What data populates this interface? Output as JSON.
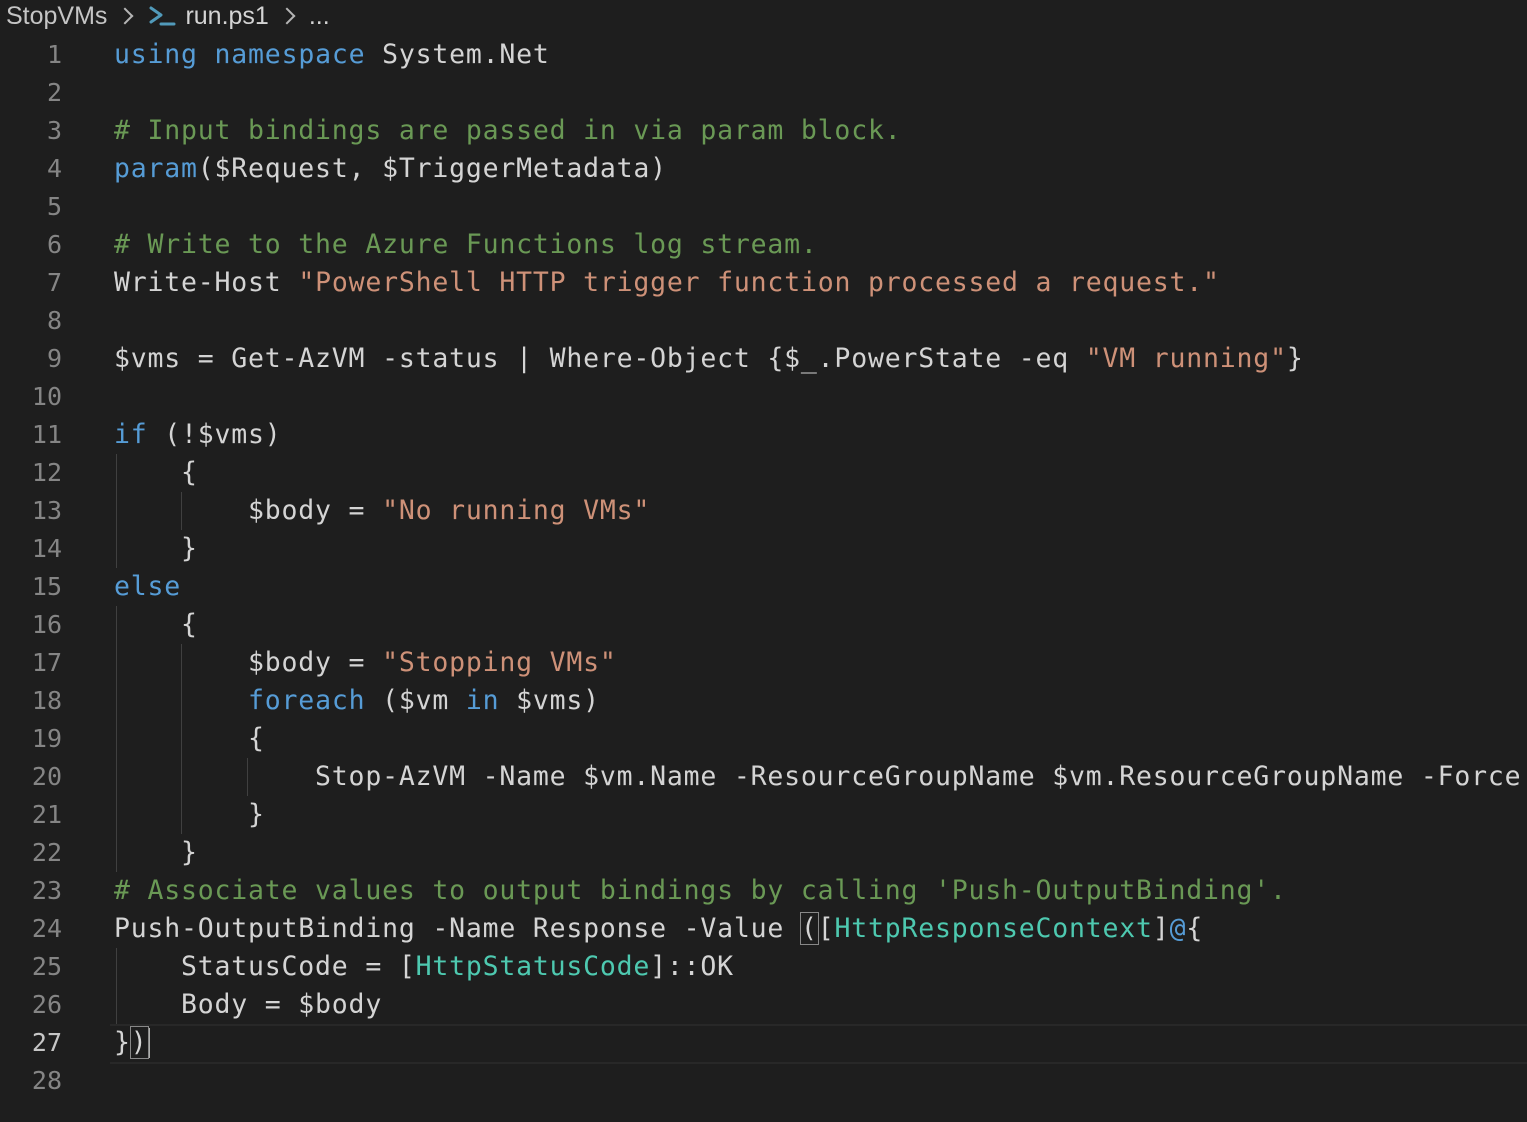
{
  "breadcrumb": {
    "folder": "StopVMs",
    "file": "run.ps1",
    "more": "..."
  },
  "colors": {
    "background": "#1e1e1e",
    "keyword": "#569cd6",
    "string": "#ce9178",
    "comment": "#6a9955",
    "text": "#d4d4d4",
    "type": "#4ec9b0",
    "line_number": "#858585"
  },
  "editor": {
    "active_line": 27,
    "lines": [
      {
        "n": "1",
        "tokens": [
          {
            "t": "using",
            "c": "kw"
          },
          {
            "t": " "
          },
          {
            "t": "namespace",
            "c": "kw"
          },
          {
            "t": " System.Net"
          }
        ]
      },
      {
        "n": "2",
        "tokens": []
      },
      {
        "n": "3",
        "tokens": [
          {
            "t": "# Input bindings are passed in via param block.",
            "c": "cm"
          }
        ]
      },
      {
        "n": "4",
        "tokens": [
          {
            "t": "param",
            "c": "kw"
          },
          {
            "t": "($Request, $TriggerMetadata)"
          }
        ]
      },
      {
        "n": "5",
        "tokens": []
      },
      {
        "n": "6",
        "tokens": [
          {
            "t": "# Write to the Azure Functions log stream.",
            "c": "cm"
          }
        ]
      },
      {
        "n": "7",
        "tokens": [
          {
            "t": "Write-Host "
          },
          {
            "t": "\"PowerShell HTTP trigger function processed a request.\"",
            "c": "str"
          }
        ]
      },
      {
        "n": "8",
        "tokens": []
      },
      {
        "n": "9",
        "tokens": [
          {
            "t": "$vms = Get-AzVM -status | Where-Object {$_.PowerState -eq "
          },
          {
            "t": "\"VM running\"",
            "c": "str"
          },
          {
            "t": "}"
          }
        ]
      },
      {
        "n": "10",
        "tokens": []
      },
      {
        "n": "11",
        "tokens": [
          {
            "t": "if",
            "c": "kw"
          },
          {
            "t": " (!$vms)"
          }
        ]
      },
      {
        "n": "12",
        "tokens": [
          {
            "t": "    {"
          }
        ]
      },
      {
        "n": "13",
        "tokens": [
          {
            "t": "        $body = "
          },
          {
            "t": "\"No running VMs\"",
            "c": "str"
          }
        ]
      },
      {
        "n": "14",
        "tokens": [
          {
            "t": "    }"
          }
        ]
      },
      {
        "n": "15",
        "tokens": [
          {
            "t": "else",
            "c": "kw"
          }
        ]
      },
      {
        "n": "16",
        "tokens": [
          {
            "t": "    {"
          }
        ]
      },
      {
        "n": "17",
        "tokens": [
          {
            "t": "        $body = "
          },
          {
            "t": "\"Stopping VMs\"",
            "c": "str"
          }
        ]
      },
      {
        "n": "18",
        "tokens": [
          {
            "t": "        "
          },
          {
            "t": "foreach",
            "c": "kw"
          },
          {
            "t": " ($vm "
          },
          {
            "t": "in",
            "c": "kw"
          },
          {
            "t": " $vms)"
          }
        ]
      },
      {
        "n": "19",
        "tokens": [
          {
            "t": "        {"
          }
        ]
      },
      {
        "n": "20",
        "tokens": [
          {
            "t": "            Stop-AzVM -Name $vm.Name -ResourceGroupName $vm.ResourceGroupName -Force -"
          }
        ]
      },
      {
        "n": "21",
        "tokens": [
          {
            "t": "        }"
          }
        ]
      },
      {
        "n": "22",
        "tokens": [
          {
            "t": "    }"
          }
        ]
      },
      {
        "n": "23",
        "tokens": [
          {
            "t": "# Associate values to output bindings by calling 'Push-OutputBinding'.",
            "c": "cm"
          }
        ]
      },
      {
        "n": "24",
        "tokens": [
          {
            "t": "Push-OutputBinding -Name Response -Value "
          },
          {
            "t": "(",
            "c": "box"
          },
          {
            "t": "["
          },
          {
            "t": "HttpResponseContext",
            "c": "type"
          },
          {
            "t": "]"
          },
          {
            "t": "@",
            "c": "kw"
          },
          {
            "t": "{"
          }
        ]
      },
      {
        "n": "25",
        "tokens": [
          {
            "t": "    StatusCode = ["
          },
          {
            "t": "HttpStatusCode",
            "c": "type"
          },
          {
            "t": "]::OK"
          }
        ]
      },
      {
        "n": "26",
        "tokens": [
          {
            "t": "    Body = $body"
          }
        ]
      },
      {
        "n": "27",
        "tokens": [
          {
            "t": "}"
          },
          {
            "t": ")",
            "c": "box"
          }
        ]
      },
      {
        "n": "28",
        "tokens": []
      }
    ]
  }
}
